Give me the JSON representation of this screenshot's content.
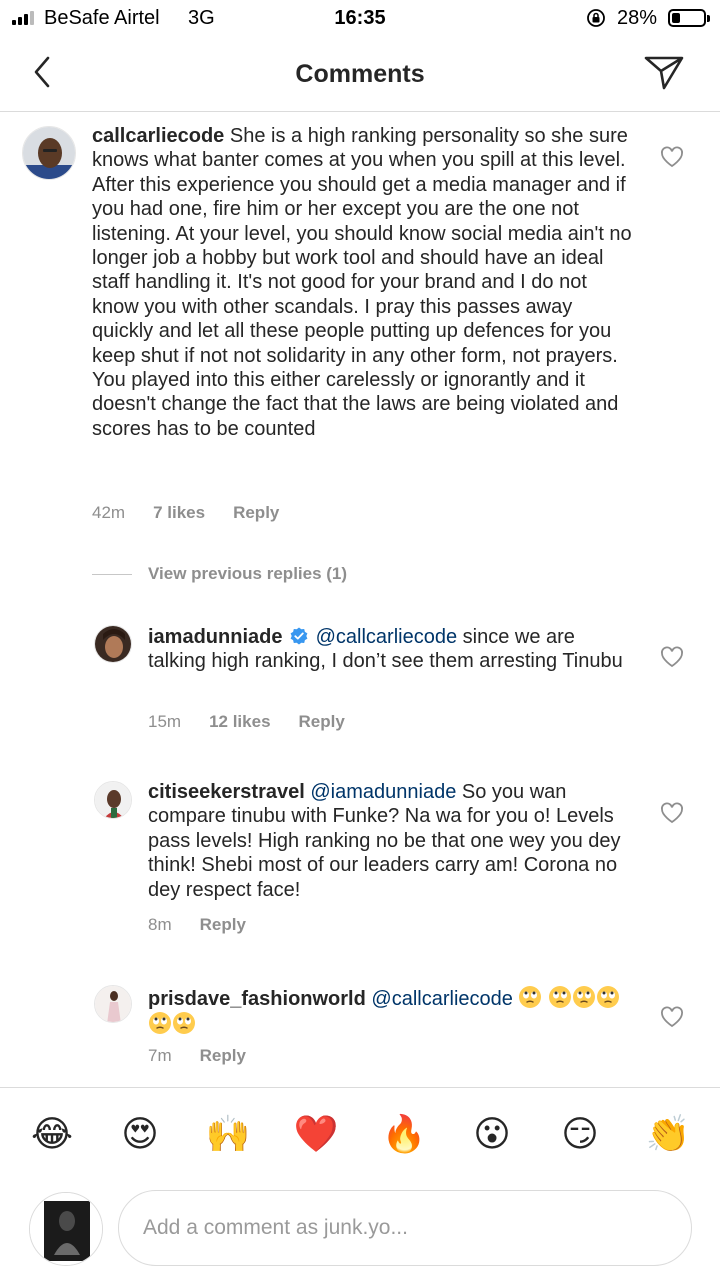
{
  "status_bar": {
    "carrier": "BeSafe Airtel",
    "network": "3G",
    "time": "16:35",
    "battery_percent": "28%",
    "battery_level": 0.28
  },
  "header": {
    "title": "Comments",
    "back_icon": "chevron-left-icon",
    "send_icon": "paper-plane-icon"
  },
  "comments": [
    {
      "username": "callcarliecode",
      "text": "She is a high ranking personality so she sure knows what banter comes at you when you spill at this level. After this experience you should get a media manager and if you had one, fire him or her except you are the one not listening. At your level, you should know social media ain't no longer job a hobby but work tool and should have an ideal staff handling it. It's not good for your brand and I do not know you with other scandals. I pray this passes away quickly and let all these people putting up defences for you keep shut if not not solidarity in any other form, not prayers. You played into this either carelessly or ignorantly and it doesn't change the fact that the laws are being violated and scores has to be counted",
      "time": "42m",
      "likes": "7 likes",
      "reply": "Reply"
    }
  ],
  "view_previous": "View previous replies (1)",
  "replies": [
    {
      "username": "iamadunniade",
      "verified": true,
      "mention": "@callcarliecode",
      "text": " since we are talking high ranking, I don’t see them arresting Tinubu",
      "time": "15m",
      "likes": "12 likes",
      "reply": "Reply"
    },
    {
      "username": "citiseekerstravel",
      "mention": "@iamadunniade",
      "text": " So you wan compare tinubu with Funke? Na wa for you o! Levels pass levels! High ranking no be that one wey you dey think! Shebi most of our leaders carry am! Corona no dey respect face!",
      "time": "8m",
      "reply": "Reply"
    },
    {
      "username": "prisdave_fashionworld",
      "mention": "@callcarliecode",
      "emoji_icon": "face-with-rolling-eyes-icon",
      "emoji_count": 6,
      "time": "7m",
      "reply": "Reply"
    }
  ],
  "emoji_bar": [
    "😂",
    "😍",
    "🙌",
    "❤️",
    "🔥",
    "😮",
    "😏",
    "👏"
  ],
  "comment_input": {
    "placeholder": "Add a comment as junk.yo..."
  }
}
